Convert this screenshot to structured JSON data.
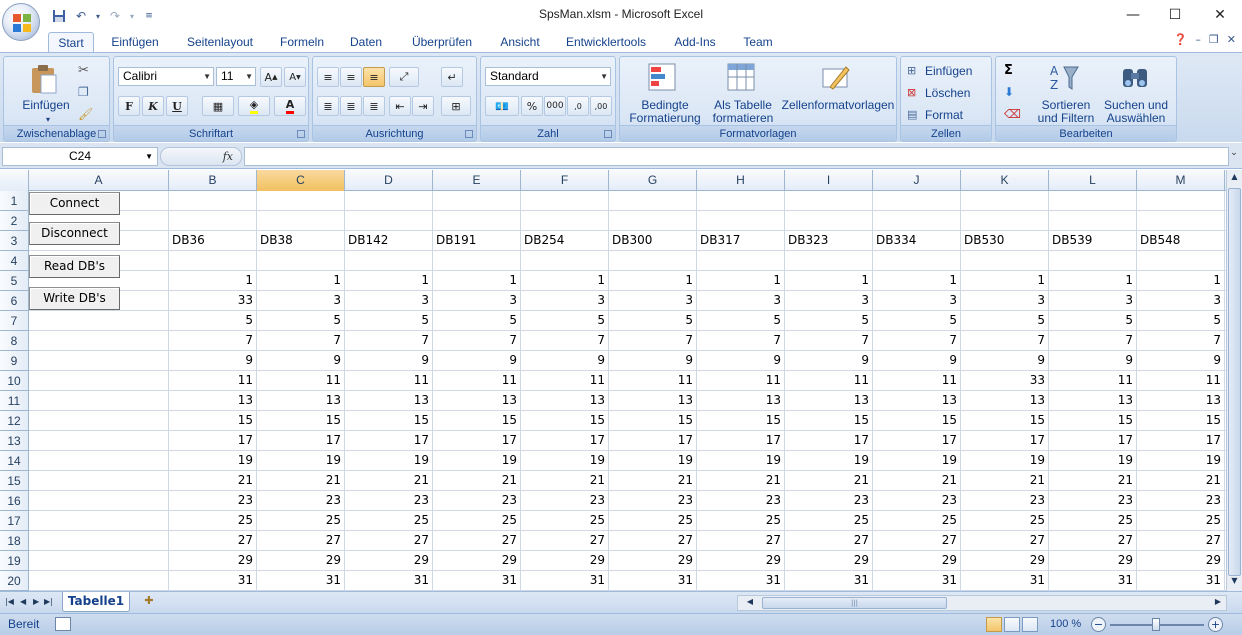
{
  "window": {
    "title": "SpsMan.xlsm - Microsoft Excel",
    "minimize": "—",
    "maximize": "☐",
    "close": "✕"
  },
  "qat": {
    "save_icon": "save-icon",
    "undo_icon": "undo-icon",
    "redo_icon": "redo-icon",
    "customize_icon": "customize-icon"
  },
  "tabs": [
    "Start",
    "Einfügen",
    "Seitenlayout",
    "Formeln",
    "Daten",
    "Überprüfen",
    "Ansicht",
    "Entwicklertools",
    "Add-Ins",
    "Team"
  ],
  "ribbon": {
    "clipboard": {
      "label": "Zwischenablage",
      "paste": "Einfügen"
    },
    "font": {
      "label": "Schriftart",
      "name": "Calibri",
      "size": "11",
      "bold": "F",
      "italic": "K",
      "underline": "U"
    },
    "alignment": {
      "label": "Ausrichtung"
    },
    "number": {
      "label": "Zahl",
      "format": "Standard"
    },
    "styles": {
      "label": "Formatvorlagen",
      "conditional_1": "Bedingte",
      "conditional_2": "Formatierung",
      "table_1": "Als Tabelle",
      "table_2": "formatieren",
      "cell_styles": "Zellenformatvorlagen"
    },
    "cells": {
      "label": "Zellen",
      "insert": "Einfügen",
      "delete": "Löschen",
      "format": "Format"
    },
    "editing": {
      "label": "Bearbeiten",
      "sort_1": "Sortieren",
      "sort_2": "und Filtern",
      "find_1": "Suchen und",
      "find_2": "Auswählen"
    }
  },
  "formula_bar": {
    "name_box": "C24",
    "fx": "fx",
    "formula": ""
  },
  "sheet": {
    "columns": [
      "A",
      "B",
      "C",
      "D",
      "E",
      "F",
      "G",
      "H",
      "I",
      "J",
      "K",
      "L",
      "M"
    ],
    "selected_column": "C",
    "rows": [
      "1",
      "2",
      "3",
      "4",
      "5",
      "6",
      "7",
      "8",
      "9",
      "10",
      "11",
      "12",
      "13",
      "14",
      "15",
      "16",
      "17",
      "18",
      "19",
      "20"
    ],
    "headers_row3": [
      "DB36",
      "DB38",
      "DB142",
      "DB191",
      "DB254",
      "DB300",
      "DB317",
      "DB323",
      "DB334",
      "DB530",
      "DB539",
      "DB548"
    ],
    "data": [
      [
        "1",
        "1",
        "1",
        "1",
        "1",
        "1",
        "1",
        "1",
        "1",
        "1",
        "1",
        "1"
      ],
      [
        "33",
        "3",
        "3",
        "3",
        "3",
        "3",
        "3",
        "3",
        "3",
        "3",
        "3",
        "3"
      ],
      [
        "5",
        "5",
        "5",
        "5",
        "5",
        "5",
        "5",
        "5",
        "5",
        "5",
        "5",
        "5"
      ],
      [
        "7",
        "7",
        "7",
        "7",
        "7",
        "7",
        "7",
        "7",
        "7",
        "7",
        "7",
        "7"
      ],
      [
        "9",
        "9",
        "9",
        "9",
        "9",
        "9",
        "9",
        "9",
        "9",
        "9",
        "9",
        "9"
      ],
      [
        "11",
        "11",
        "11",
        "11",
        "11",
        "11",
        "11",
        "11",
        "11",
        "33",
        "11",
        "11"
      ],
      [
        "13",
        "13",
        "13",
        "13",
        "13",
        "13",
        "13",
        "13",
        "13",
        "13",
        "13",
        "13"
      ],
      [
        "15",
        "15",
        "15",
        "15",
        "15",
        "15",
        "15",
        "15",
        "15",
        "15",
        "15",
        "15"
      ],
      [
        "17",
        "17",
        "17",
        "17",
        "17",
        "17",
        "17",
        "17",
        "17",
        "17",
        "17",
        "17"
      ],
      [
        "19",
        "19",
        "19",
        "19",
        "19",
        "19",
        "19",
        "19",
        "19",
        "19",
        "19",
        "19"
      ],
      [
        "21",
        "21",
        "21",
        "21",
        "21",
        "21",
        "21",
        "21",
        "21",
        "21",
        "21",
        "21"
      ],
      [
        "23",
        "23",
        "23",
        "23",
        "23",
        "23",
        "23",
        "23",
        "23",
        "23",
        "23",
        "23"
      ],
      [
        "25",
        "25",
        "25",
        "25",
        "25",
        "25",
        "25",
        "25",
        "25",
        "25",
        "25",
        "25"
      ],
      [
        "27",
        "27",
        "27",
        "27",
        "27",
        "27",
        "27",
        "27",
        "27",
        "27",
        "27",
        "27"
      ],
      [
        "29",
        "29",
        "29",
        "29",
        "29",
        "29",
        "29",
        "29",
        "29",
        "29",
        "29",
        "29"
      ],
      [
        "31",
        "31",
        "31",
        "31",
        "31",
        "31",
        "31",
        "31",
        "31",
        "31",
        "31",
        "31"
      ]
    ],
    "buttons": [
      "Connect",
      "Disconnect",
      "Read DB's",
      "Write DB's"
    ]
  },
  "sheet_tabs": {
    "active": "Tabelle1"
  },
  "status": {
    "text": "Bereit",
    "zoom": "100 %",
    "zoom_minus": "−",
    "zoom_plus": "+"
  }
}
